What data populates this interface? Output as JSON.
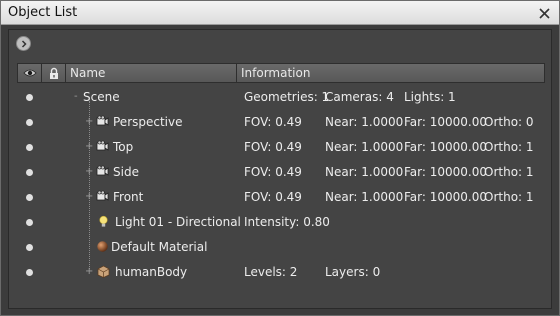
{
  "window": {
    "title": "Object List",
    "close_label": "✕"
  },
  "toolbar": {
    "expand_icon": "chevron-right-icon"
  },
  "columns": {
    "eye_icon": "eye-icon",
    "lock_icon": "lock-icon",
    "name": "Name",
    "information": "Information"
  },
  "rows": [
    {
      "name": "Scene",
      "icon": "none",
      "expander": "-",
      "info": [
        "Geometries: 1",
        "Cameras: 4",
        "Lights: 1"
      ]
    },
    {
      "name": "Perspective",
      "icon": "camera-icon",
      "expander": "+",
      "info": [
        "FOV: 0.49",
        "Near: 1.0000",
        "Far: 10000.00",
        "Ortho: 0"
      ]
    },
    {
      "name": "Top",
      "icon": "camera-icon",
      "expander": "+",
      "info": [
        "FOV: 0.49",
        "Near: 1.0000",
        "Far: 10000.00",
        "Ortho: 1"
      ]
    },
    {
      "name": "Side",
      "icon": "camera-icon",
      "expander": "+",
      "info": [
        "FOV: 0.49",
        "Near: 1.0000",
        "Far: 10000.00",
        "Ortho: 1"
      ]
    },
    {
      "name": "Front",
      "icon": "camera-icon",
      "expander": "+",
      "info": [
        "FOV: 0.49",
        "Near: 1.0000",
        "Far: 10000.00",
        "Ortho: 1"
      ]
    },
    {
      "name": "Light 01 - Directional",
      "icon": "light-bulb-icon",
      "expander": "",
      "info": [
        "Intensity: 0.80"
      ]
    },
    {
      "name": "Default Material",
      "icon": "material-sphere-icon",
      "expander": "",
      "info": []
    },
    {
      "name": "humanBody",
      "icon": "mesh-cube-icon",
      "expander": "+",
      "info": [
        "Levels: 2",
        "Layers: 0"
      ]
    }
  ]
}
